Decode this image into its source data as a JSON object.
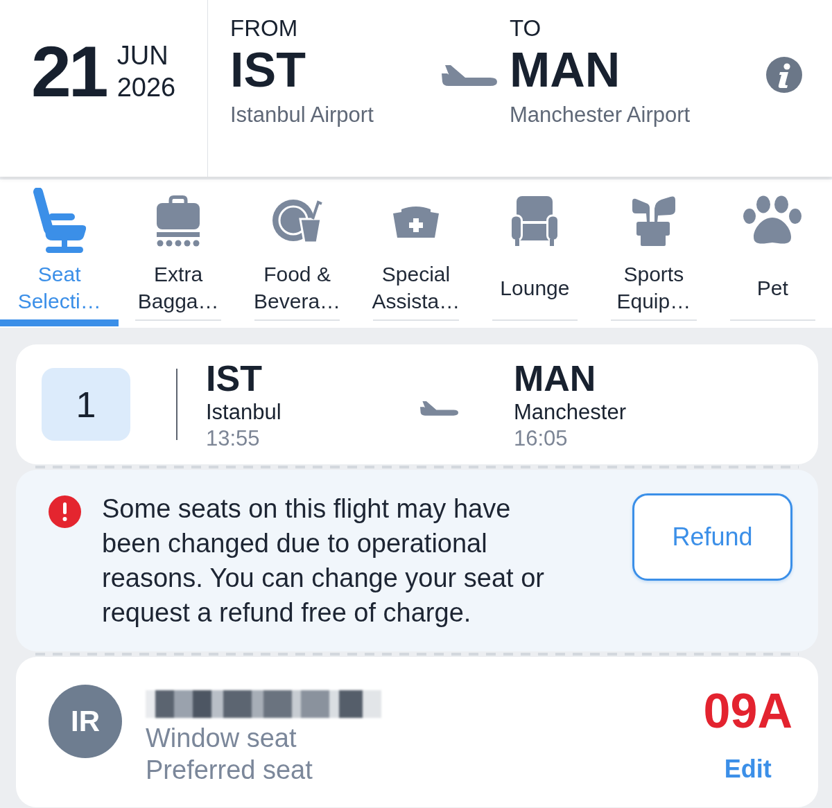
{
  "header": {
    "date": {
      "day": "21",
      "month": "JUN",
      "year": "2026"
    },
    "origin": {
      "label": "FROM",
      "code": "IST",
      "airport": "Istanbul Airport"
    },
    "destination": {
      "label": "TO",
      "code": "MAN",
      "airport": "Manchester Airport"
    }
  },
  "tabs": [
    {
      "kind": "seat",
      "label": "Seat Selecti…",
      "selected": true
    },
    {
      "kind": "baggage",
      "label": "Extra Bagga…",
      "selected": false
    },
    {
      "kind": "food",
      "label": "Food & Bevera…",
      "selected": false
    },
    {
      "kind": "assistance",
      "label": "Special Assista…",
      "selected": false
    },
    {
      "kind": "lounge",
      "label": "Lounge",
      "selected": false
    },
    {
      "kind": "sports",
      "label": "Sports Equip…",
      "selected": false
    },
    {
      "kind": "pet",
      "label": "Pet",
      "selected": false
    }
  ],
  "flight": {
    "segment": "1",
    "origin": {
      "code": "IST",
      "city": "Istanbul",
      "time": "13:55"
    },
    "destination": {
      "code": "MAN",
      "city": "Manchester",
      "time": "16:05"
    }
  },
  "notice": {
    "message": "Some seats on this flight may have been changed due to operational reasons. You can change your seat or request a refund free of charge.",
    "button": "Refund"
  },
  "passenger": {
    "initials": "IR",
    "details": [
      "Window seat",
      "Preferred seat"
    ],
    "seat": "09A",
    "action": "Edit"
  }
}
